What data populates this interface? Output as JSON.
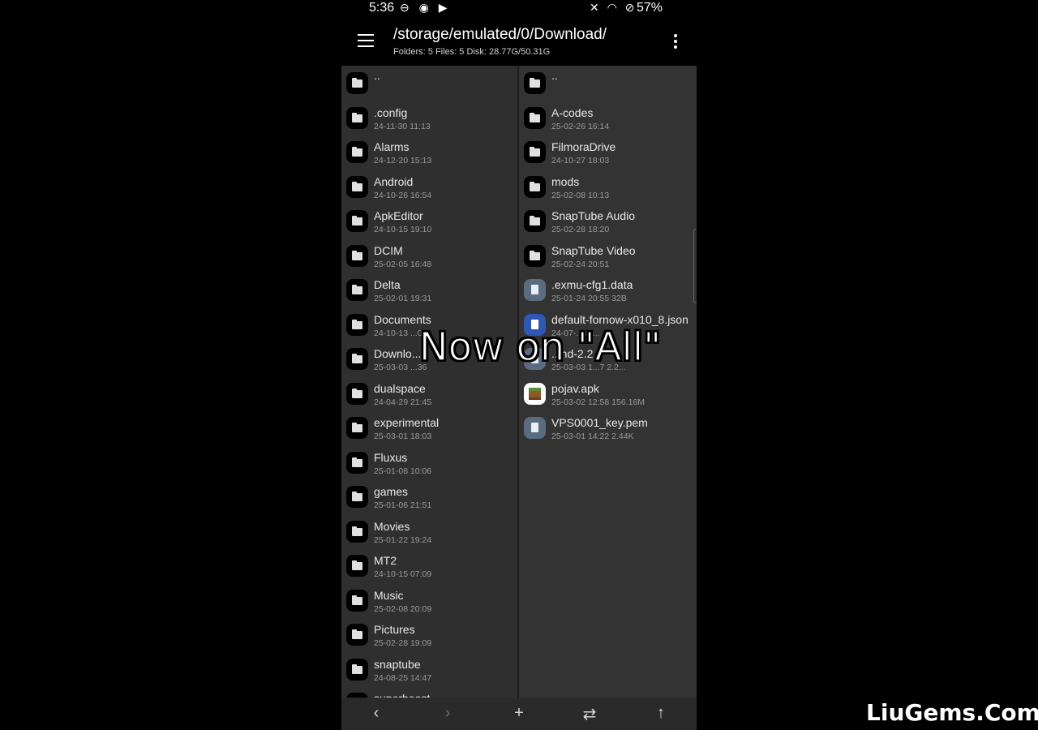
{
  "status": {
    "time": "5:36",
    "battery": "57%"
  },
  "appbar": {
    "path": "/storage/emulated/0/Download/",
    "info": "Folders: 5  Files: 5  Disk: 28.77G/50.31G"
  },
  "left_pane": [
    {
      "name": "..",
      "meta": "",
      "type": "folder"
    },
    {
      "name": ".config",
      "meta": "24-11-30 11:13",
      "type": "folder"
    },
    {
      "name": "Alarms",
      "meta": "24-12-20 15:13",
      "type": "folder"
    },
    {
      "name": "Android",
      "meta": "24-10-26 16:54",
      "type": "folder"
    },
    {
      "name": "ApkEditor",
      "meta": "24-10-15 19:10",
      "type": "folder"
    },
    {
      "name": "DCIM",
      "meta": "25-02-05 16:48",
      "type": "folder"
    },
    {
      "name": "Delta",
      "meta": "25-02-01 19:31",
      "type": "folder"
    },
    {
      "name": "Documents",
      "meta": "24-10-13 ...00",
      "type": "folder"
    },
    {
      "name": "Downlo...",
      "meta": "25-03-03 ...36",
      "type": "folder"
    },
    {
      "name": "dualspace",
      "meta": "24-04-29 21:45",
      "type": "folder"
    },
    {
      "name": "experimental",
      "meta": "25-03-01 18:03",
      "type": "folder"
    },
    {
      "name": "Fluxus",
      "meta": "25-01-08 10:06",
      "type": "folder"
    },
    {
      "name": "games",
      "meta": "25-01-06 21:51",
      "type": "folder"
    },
    {
      "name": "Movies",
      "meta": "25-01-22 19:24",
      "type": "folder"
    },
    {
      "name": "MT2",
      "meta": "24-10-15 07:09",
      "type": "folder"
    },
    {
      "name": "Music",
      "meta": "25-02-08 20:09",
      "type": "folder"
    },
    {
      "name": "Pictures",
      "meta": "25-02-28 19:09",
      "type": "folder"
    },
    {
      "name": "snaptube",
      "meta": "24-08-25 14:47",
      "type": "folder"
    },
    {
      "name": "superboost",
      "meta": "",
      "type": "folder"
    }
  ],
  "right_pane": [
    {
      "name": "..",
      "meta": "",
      "type": "folder"
    },
    {
      "name": "A-codes",
      "meta": "25-02-26 16:14",
      "type": "folder"
    },
    {
      "name": "FilmoraDrive",
      "meta": "24-10-27 18:03",
      "type": "folder"
    },
    {
      "name": "mods",
      "meta": "25-02-08 10:13",
      "type": "folder"
    },
    {
      "name": "SnapTube Audio",
      "meta": "25-02-28 18:20",
      "type": "folder"
    },
    {
      "name": "SnapTube Video",
      "meta": "25-02-24 20:51",
      "type": "folder"
    },
    {
      "name": ".exmu-cfg1.data",
      "meta": "25-01-24 20:55  32B",
      "type": "file"
    },
    {
      "name": "default-fornow-x010_8.json",
      "meta": "24-07-...16...",
      "type": "json"
    },
    {
      "name": "...nd-2.2...",
      "meta": "25-03-03 1...7  2.2...",
      "type": "file"
    },
    {
      "name": "pojav.apk",
      "meta": "25-03-02 12:58  156.16M",
      "type": "apk"
    },
    {
      "name": "VPS0001_key.pem",
      "meta": "25-03-01 14:22  2.44K",
      "type": "file"
    }
  ],
  "bottombar": {
    "back": "‹",
    "forward": "›",
    "add": "+",
    "swap": "⇄",
    "up": "↑"
  },
  "overlay": {
    "caption": "Now on \"All\"",
    "watermark": "LiuGems.Com"
  }
}
